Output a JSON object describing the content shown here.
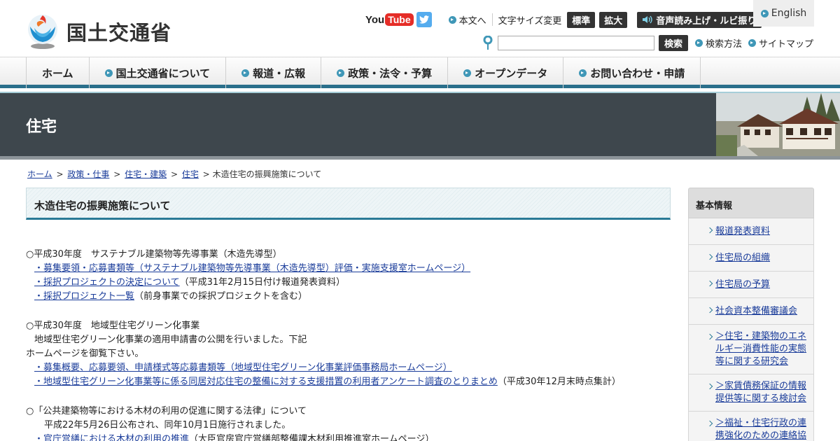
{
  "header": {
    "logo_text": "国土交通省",
    "youtube_you": "You",
    "youtube_tube": "Tube",
    "honbun": "本文へ",
    "font_size_label": "文字サイズ変更",
    "font_standard": "標準",
    "font_large": "拡大",
    "voice": "音声読み上げ・ルビ振り",
    "english": "English",
    "search_button": "検索",
    "search_method": "検索方法",
    "sitemap": "サイトマップ"
  },
  "nav": {
    "items": [
      {
        "label": "ホーム"
      },
      {
        "label": "国土交通省について"
      },
      {
        "label": "報道・広報"
      },
      {
        "label": "政策・法令・予算"
      },
      {
        "label": "オープンデータ"
      },
      {
        "label": "お問い合わせ・申請"
      }
    ]
  },
  "banner": {
    "title": "住宅"
  },
  "breadcrumb": {
    "items": [
      "ホーム",
      "政策・仕事",
      "住宅・建築",
      "住宅"
    ],
    "current": "木造住宅の振興施策について",
    "separator": ">"
  },
  "main": {
    "title": "木造住宅の振興施策について",
    "s1_heading": "○平成30年度　サステナブル建築物等先導事業（木造先導型）",
    "s1_link1": "・募集要領・応募書類等（サステナブル建築物等先導事業（木造先導型）評価・実施支援室ホームページ）",
    "s1_link2": "・採択プロジェクトの決定について",
    "s1_link2_note": "（平成31年2月15日付け報道発表資料）",
    "s1_link3": "・採択プロジェクト一覧",
    "s1_link3_note": "（前身事業での採択プロジェクトを含む）",
    "s2_heading": "○平成30年度　地域型住宅グリーン化事業",
    "s2_text1": "地域型住宅グリーン化事業の適用申請書の公開を行いました。下記",
    "s2_text2": "ホームページを御覧下さい。",
    "s2_link1": "・募集概要、応募要領、申請様式等応募書類等（地域型住宅グリーン化事業評価事務局ホームページ）",
    "s2_link2": "・地域型住宅グリーン化事業等に係る同居対応住宅の整備に対する支援措置の利用者アンケート調査のとりまとめ",
    "s2_link2_note": "（平成30年12月末時点集計）",
    "s3_heading": "○「公共建築物等における木材の利用の促進に関する法律」について",
    "s3_text1": "平成22年5月26日公布され、同年10月1日施行されました。",
    "s3_link1": "・官庁営繕における木材の利用の推進",
    "s3_link1_note": "（大臣官房官庁営繕部整備課木材利用推進室ホームページ）"
  },
  "sidebar": {
    "heading": "基本情報",
    "items": [
      {
        "label": "報道発表資料"
      },
      {
        "label": "住宅局の組織"
      },
      {
        "label": "住宅局の予算"
      },
      {
        "label": "社会資本整備審議会"
      },
      {
        "label": "＞住宅・建築物のエネルギー消費性能の実態等に関する研究会"
      },
      {
        "label": "＞家賃債務保証の情報提供等に関する検討会"
      },
      {
        "label": "＞福祉・住宅行政の連携強化のための連絡協"
      }
    ]
  },
  "colors": {
    "accent": "#2a7a96",
    "banner": "#3e474d",
    "link": "#1a3c9a"
  }
}
